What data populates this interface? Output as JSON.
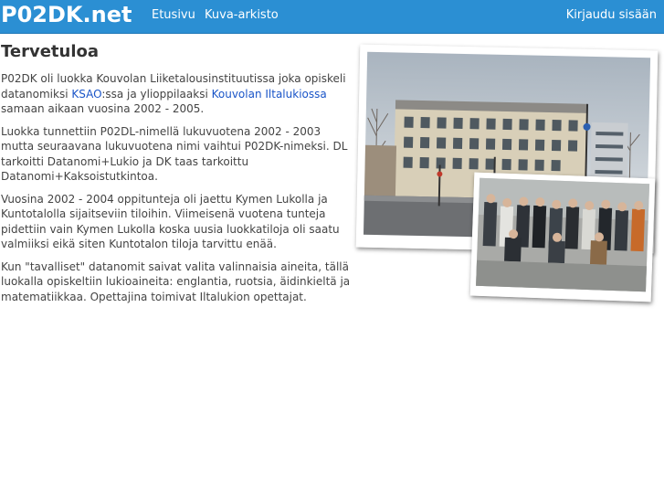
{
  "header": {
    "brand": "P02DK.net",
    "nav": [
      "Etusivu",
      "Kuva-arkisto"
    ],
    "login": "Kirjaudu sisään"
  },
  "main": {
    "title": "Tervetuloa",
    "p1": {
      "a": "P02DK oli luokka Kouvolan Liiketalousinstituutissa joka opiskeli datanomiksi ",
      "link1": "KSAO",
      "b": ":ssa ja ylioppilaaksi ",
      "link2": "Kouvolan Iltalukiossa",
      "c": " samaan aikaan vuosina 2002 - 2005."
    },
    "p2": "Luokka tunnettiin P02DL-nimellä lukuvuotena 2002 - 2003 mutta seuraavana lukuvuotena nimi vaihtui P02DK-nimeksi. DL tarkoitti Datanomi+Lukio ja DK taas tarkoittu Datanomi+Kaksoistutkintoa.",
    "p3": "Vuosina 2002 - 2004 oppitunteja oli jaettu Kymen Lukolla ja Kuntotalolla sijaitseviin tiloihin. Viimeisenä vuotena tunteja pidettiin vain Kymen Lukolla koska uusia luokkatiloja oli saatu valmiiksi eikä siten Kuntotalon tiloja tarvittu enää.",
    "p4": "Kun \"tavalliset\" datanomit saivat valita valinnaisia aineita, tällä luokalla opiskeltiin lukioaineita: englantia, ruotsia, äidinkieltä ja matematiikkaa. Opettajina toimivat Iltalukion opettajat."
  },
  "colors": {
    "navbar": "#2b8fd3",
    "link": "#1a55c8",
    "text": "#444444"
  },
  "images": {
    "building": "school-building-photo",
    "group": "class-group-photo"
  }
}
